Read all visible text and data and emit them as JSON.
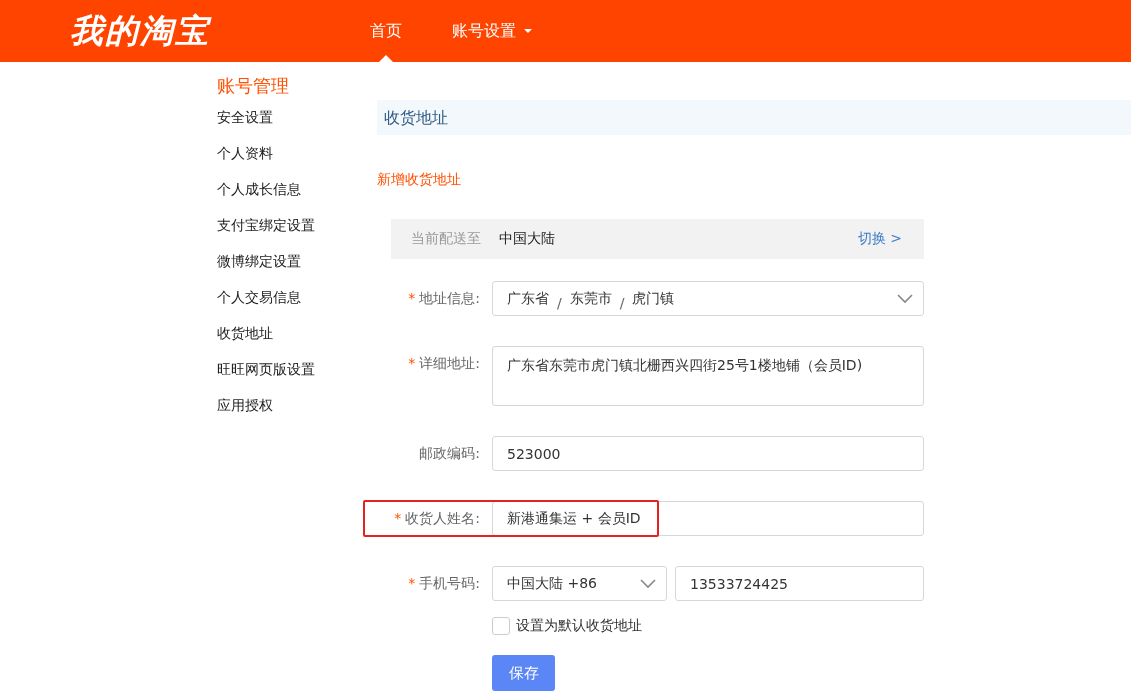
{
  "header": {
    "logo": "我的淘宝",
    "nav": [
      {
        "label": "首页",
        "selected": true,
        "dropdown": false
      },
      {
        "label": "账号设置",
        "selected": false,
        "dropdown": true
      }
    ]
  },
  "sidebar": {
    "title": "账号管理",
    "items": [
      "安全设置",
      "个人资料",
      "个人成长信息",
      "支付宝绑定设置",
      "微博绑定设置",
      "个人交易信息",
      "收货地址",
      "旺旺网页版设置",
      "应用授权"
    ]
  },
  "page_title": "收货地址",
  "add_link": "新增收货地址",
  "delivery": {
    "label": "当前配送至",
    "region": "中国大陆",
    "switch_link": "切换 >"
  },
  "form": {
    "fields": [
      {
        "kind": "region",
        "label": "地址信息:",
        "required_mark": "*",
        "highlighted": false,
        "parts": [
          "广东省",
          "东莞市",
          "虎门镇"
        ],
        "separators": [
          "/",
          "/"
        ]
      },
      {
        "kind": "textarea",
        "label": "详细地址:",
        "required_mark": "*",
        "highlighted": false,
        "value": "广东省东莞市虎门镇北栅西兴四街25号1楼地铺（会员ID)"
      },
      {
        "kind": "text",
        "label": "邮政编码:",
        "highlighted": false,
        "value": "523000"
      },
      {
        "kind": "text",
        "label": "收货人姓名:",
        "required_mark": "*",
        "highlighted": true,
        "value": "新港通集运 + 会员ID"
      },
      {
        "kind": "phone",
        "label": "手机号码:",
        "required_mark": "*",
        "highlighted": false,
        "country": "中国大陆 +86",
        "value": "13533724425"
      }
    ],
    "default_checkbox": {
      "label": "设置为默认收货地址",
      "checked": false
    },
    "save_button": "保存"
  }
}
